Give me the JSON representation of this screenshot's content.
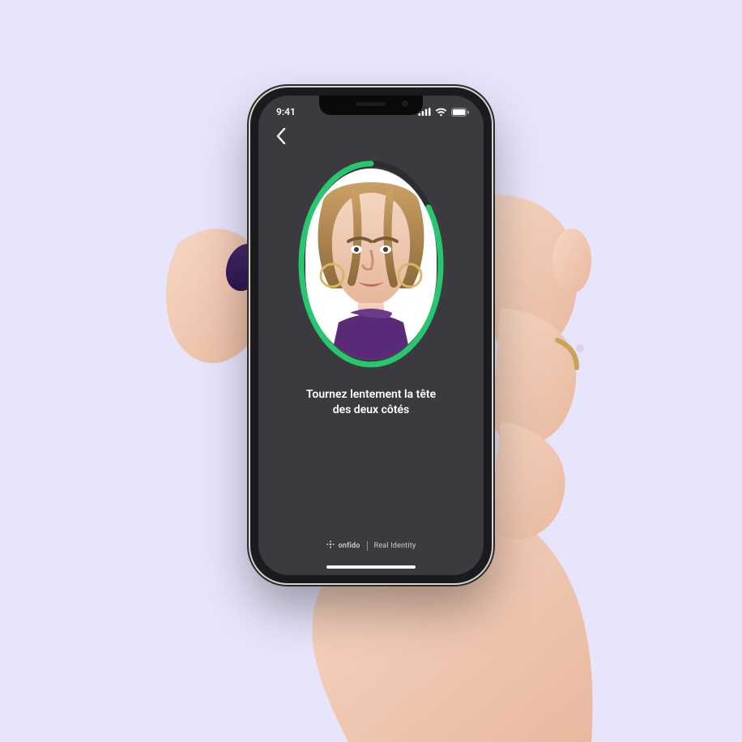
{
  "status": {
    "time": "9:41",
    "signal_icon": "signal-icon",
    "wifi_icon": "wifi-icon",
    "battery_icon": "battery-icon"
  },
  "nav": {
    "back_icon": "chevron-left-icon"
  },
  "capture": {
    "progress_color": "#28c76f",
    "track_color": "#2f2f34",
    "instruction_line1": "Tournez lentement la tête",
    "instruction_line2": "des deux côtés"
  },
  "footer": {
    "brand": "onfido",
    "tagline": "Real Identity"
  },
  "colors": {
    "page_bg": "#e7e5fb",
    "screen_bg": "#3a3a3f",
    "accent": "#28c76f",
    "text": "#ffffff"
  }
}
